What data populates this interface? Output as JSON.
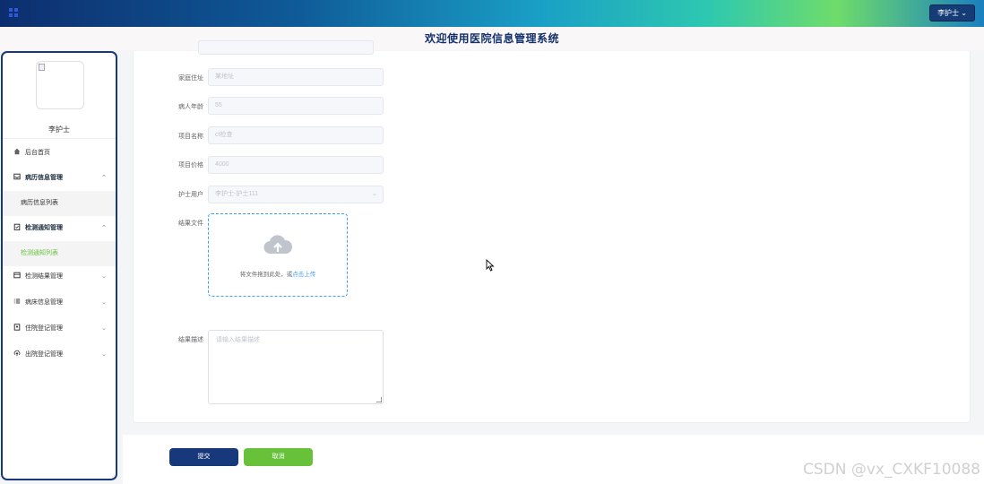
{
  "header": {
    "user_button": "李护士 ⌄"
  },
  "title": "欢迎使用医院信息管理系统",
  "sidebar": {
    "username": "李护士",
    "items": [
      {
        "label": "后台首页",
        "icon": "home-icon"
      },
      {
        "label": "病历信息管理",
        "icon": "inbox-icon",
        "chevron": "⌃"
      },
      {
        "label": "病历信息列表"
      },
      {
        "label": "检测通知管理",
        "icon": "clipboard-icon",
        "chevron": "⌃"
      },
      {
        "label": "检测通知列表"
      },
      {
        "label": "检测结果管理",
        "icon": "box-icon",
        "chevron": "⌄"
      },
      {
        "label": "病床信息管理",
        "icon": "list-icon",
        "chevron": "⌄"
      },
      {
        "label": "住院登记管理",
        "icon": "badge-icon",
        "chevron": "⌄"
      },
      {
        "label": "出院登记管理",
        "icon": "upload-icon",
        "chevron": "⌄"
      }
    ]
  },
  "form": {
    "fields": [
      {
        "label": "家庭住址",
        "value": "某地址"
      },
      {
        "label": "病人年龄",
        "value": "55"
      },
      {
        "label": "项目名称",
        "value": "ct检查"
      },
      {
        "label": "项目价格",
        "value": "4000"
      },
      {
        "label": "护士用户",
        "value": "李护士-护士111",
        "chevron": "⌄"
      }
    ],
    "upload_label": "结果文件",
    "upload_text": "将文件拖到此处，或",
    "upload_link": "点击上传",
    "desc_label": "结果描述",
    "desc_placeholder": "请输入结果描述"
  },
  "buttons": {
    "submit": "提交",
    "cancel": "取消"
  },
  "watermark": "CSDN @vx_CXKF10088"
}
